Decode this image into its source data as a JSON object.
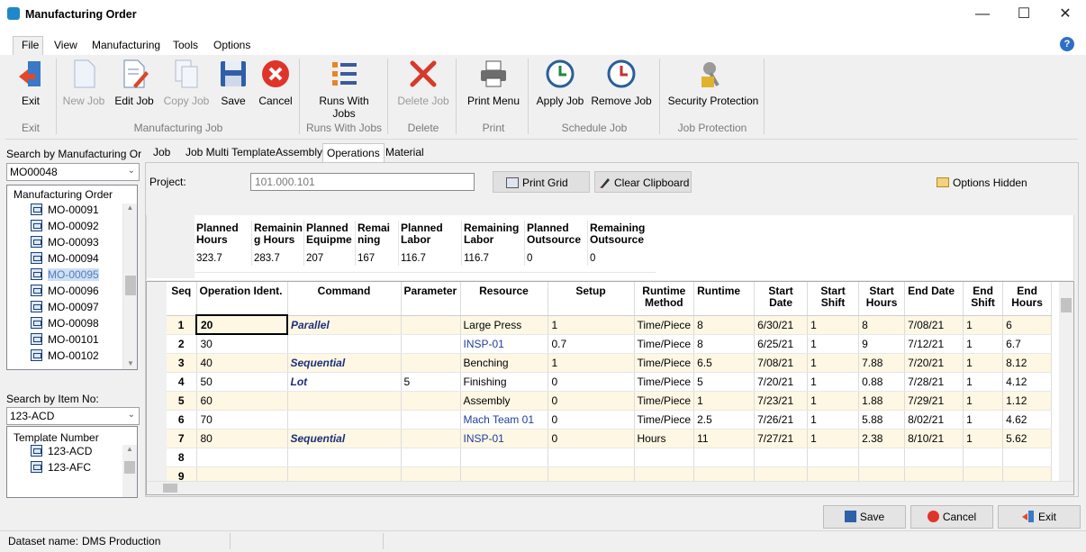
{
  "window": {
    "title": "Manufacturing Order"
  },
  "menu": [
    "File",
    "View",
    "Manufacturing",
    "Tools",
    "Options"
  ],
  "ribbon": {
    "buttons": {
      "exit": "Exit",
      "new_job": "New Job",
      "edit_job": "Edit Job",
      "copy_job": "Copy Job",
      "save": "Save",
      "cancel": "Cancel",
      "runs_with_jobs": "Runs With Jobs",
      "delete_job": "Delete Job",
      "print_menu": "Print Menu",
      "apply_job": "Apply Job",
      "remove_job": "Remove Job",
      "security_protection": "Security Protection"
    },
    "groups": {
      "exit": "Exit",
      "manufacturing_job": "Manufacturing Job",
      "runs_with_jobs": "Runs With Jobs",
      "delete": "Delete",
      "print": "Print",
      "schedule_job": "Schedule Job",
      "job_protection": "Job Protection"
    }
  },
  "left": {
    "search_mo_label": "Search by Manufacturing Orde",
    "search_mo_value": "MO00048",
    "mo_tree_header": "Manufacturing Order",
    "mo_items": [
      "MO-00091",
      "MO-00092",
      "MO-00093",
      "MO-00094",
      "MO-00095",
      "MO-00096",
      "MO-00097",
      "MO-00098",
      "MO-00101",
      "MO-00102"
    ],
    "search_item_label": "Search by Item No:",
    "search_item_value": "123-ACD",
    "template_header": "Template Number",
    "template_items": [
      "123-ACD",
      "123-AFC"
    ]
  },
  "tabs": [
    "Job",
    "Job Multi Template",
    "Assembly",
    "Operations",
    "Material"
  ],
  "content": {
    "project_label": "Project:",
    "project_value": "101.000.101",
    "print_grid": "Print Grid",
    "clear_clipboard": "Clear Clipboard",
    "options_hidden": "Options Hidden"
  },
  "summary": {
    "headers": [
      [
        "Planned",
        "Hours"
      ],
      [
        "Remainin",
        "g Hours"
      ],
      [
        "Planned",
        "Equipme"
      ],
      [
        "Remai",
        "ning"
      ],
      [
        "Planned",
        "Labor"
      ],
      [
        "Remaining",
        "Labor"
      ],
      [
        "Planned",
        "Outsource"
      ],
      [
        "Remaining",
        "Outsource"
      ]
    ],
    "values": [
      "323.7",
      "283.7",
      "207",
      "167",
      "116.7",
      "116.7",
      "0",
      "0"
    ]
  },
  "grid": {
    "headers": [
      [
        "Seq"
      ],
      [
        "Operation Ident."
      ],
      [
        "Command"
      ],
      [
        "Parameter"
      ],
      [
        "Resource"
      ],
      [
        "Setup"
      ],
      [
        "Runtime",
        "Method"
      ],
      [
        "Runtime"
      ],
      [
        "Start",
        "Date"
      ],
      [
        "Start",
        "Shift"
      ],
      [
        "Start",
        "Hours"
      ],
      [
        "End Date"
      ],
      [
        "End",
        "Shift"
      ],
      [
        "End",
        "Hours"
      ]
    ],
    "rows": [
      [
        "1",
        "20",
        "Parallel",
        "",
        "Large Press",
        "1",
        "Time/Piece",
        "8",
        "6/30/21",
        "1",
        "8",
        "7/08/21",
        "1",
        "6"
      ],
      [
        "2",
        "30",
        "",
        "",
        "INSP-01",
        "0.7",
        "Time/Piece",
        "8",
        "6/25/21",
        "1",
        "9",
        "7/12/21",
        "1",
        "6.7"
      ],
      [
        "3",
        "40",
        "Sequential",
        "",
        "Benching",
        "1",
        "Time/Piece",
        "6.5",
        "7/08/21",
        "1",
        "7.88",
        "7/20/21",
        "1",
        "8.12"
      ],
      [
        "4",
        "50",
        "Lot",
        "5",
        "Finishing",
        "0",
        "Time/Piece",
        "5",
        "7/20/21",
        "1",
        "0.88",
        "7/28/21",
        "1",
        "4.12"
      ],
      [
        "5",
        "60",
        "",
        "",
        "Assembly",
        "0",
        "Time/Piece",
        "1",
        "7/23/21",
        "1",
        "1.88",
        "7/29/21",
        "1",
        "1.12"
      ],
      [
        "6",
        "70",
        "",
        "",
        "Mach Team 01",
        "0",
        "Time/Piece",
        "2.5",
        "7/26/21",
        "1",
        "5.88",
        "8/02/21",
        "1",
        "4.62"
      ],
      [
        "7",
        "80",
        "Sequential",
        "",
        "INSP-01",
        "0",
        "Hours",
        "11",
        "7/27/21",
        "1",
        "2.38",
        "8/10/21",
        "1",
        "5.62"
      ],
      [
        "8",
        "",
        "",
        "",
        "",
        "",
        "",
        "",
        "",
        "",
        "",
        "",
        "",
        ""
      ],
      [
        "9",
        "",
        "",
        "",
        "",
        "",
        "",
        "",
        "",
        "",
        "",
        "",
        "",
        ""
      ]
    ]
  },
  "bottom": {
    "save": "Save",
    "cancel": "Cancel",
    "exit": "Exit"
  },
  "status": {
    "dataset_label": "Dataset name:",
    "dataset_value": "DMS Production"
  }
}
